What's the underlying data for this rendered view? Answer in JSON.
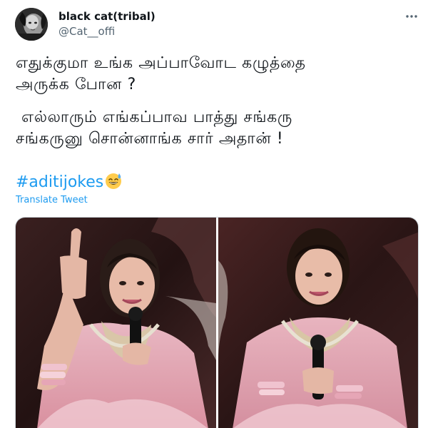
{
  "author": {
    "display_name": "black cat(tribal)",
    "handle": "@Cat__offi",
    "avatar_icon": "cat-avatar"
  },
  "menu": {
    "icon": "more-horizontal-icon"
  },
  "tweet": {
    "lines": [
      "எதுக்குமா உங்க அப்பாவோட கழுத்தை",
      "அருக்க போன ?",
      "எல்லாரும் எங்கப்பாவ பாத்து சங்கரு",
      "சங்கருனு சொன்னாங்க சார் அதான் !"
    ],
    "hashtag": "#aditijokes",
    "emoji": "grinning-face-with-sweat",
    "translate_label": "Translate Tweet"
  },
  "media": {
    "photos": [
      {
        "icon": "photo-woman-pointing"
      },
      {
        "icon": "photo-woman-smiling"
      }
    ]
  },
  "colors": {
    "link": "#1d9bf0",
    "secondary_text": "#536471",
    "saree_pink": "#e7a7b6",
    "backdrop": "#2a1717"
  }
}
